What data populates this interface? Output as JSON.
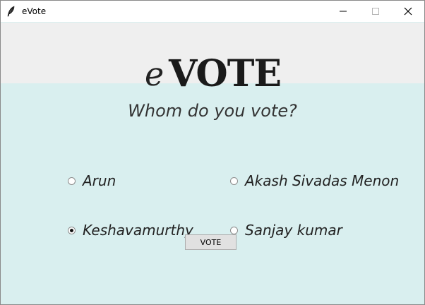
{
  "window": {
    "title": "eVote"
  },
  "logo": {
    "prefix": "e",
    "main": "VOTE"
  },
  "question": "Whom do you vote?",
  "candidates": [
    {
      "label": "Arun",
      "selected": false
    },
    {
      "label": "Akash Sivadas Menon",
      "selected": false
    },
    {
      "label": "Keshavamurthy",
      "selected": true
    },
    {
      "label": "Sanjay kumar",
      "selected": false
    }
  ],
  "vote_button": {
    "label": "VOTE"
  }
}
